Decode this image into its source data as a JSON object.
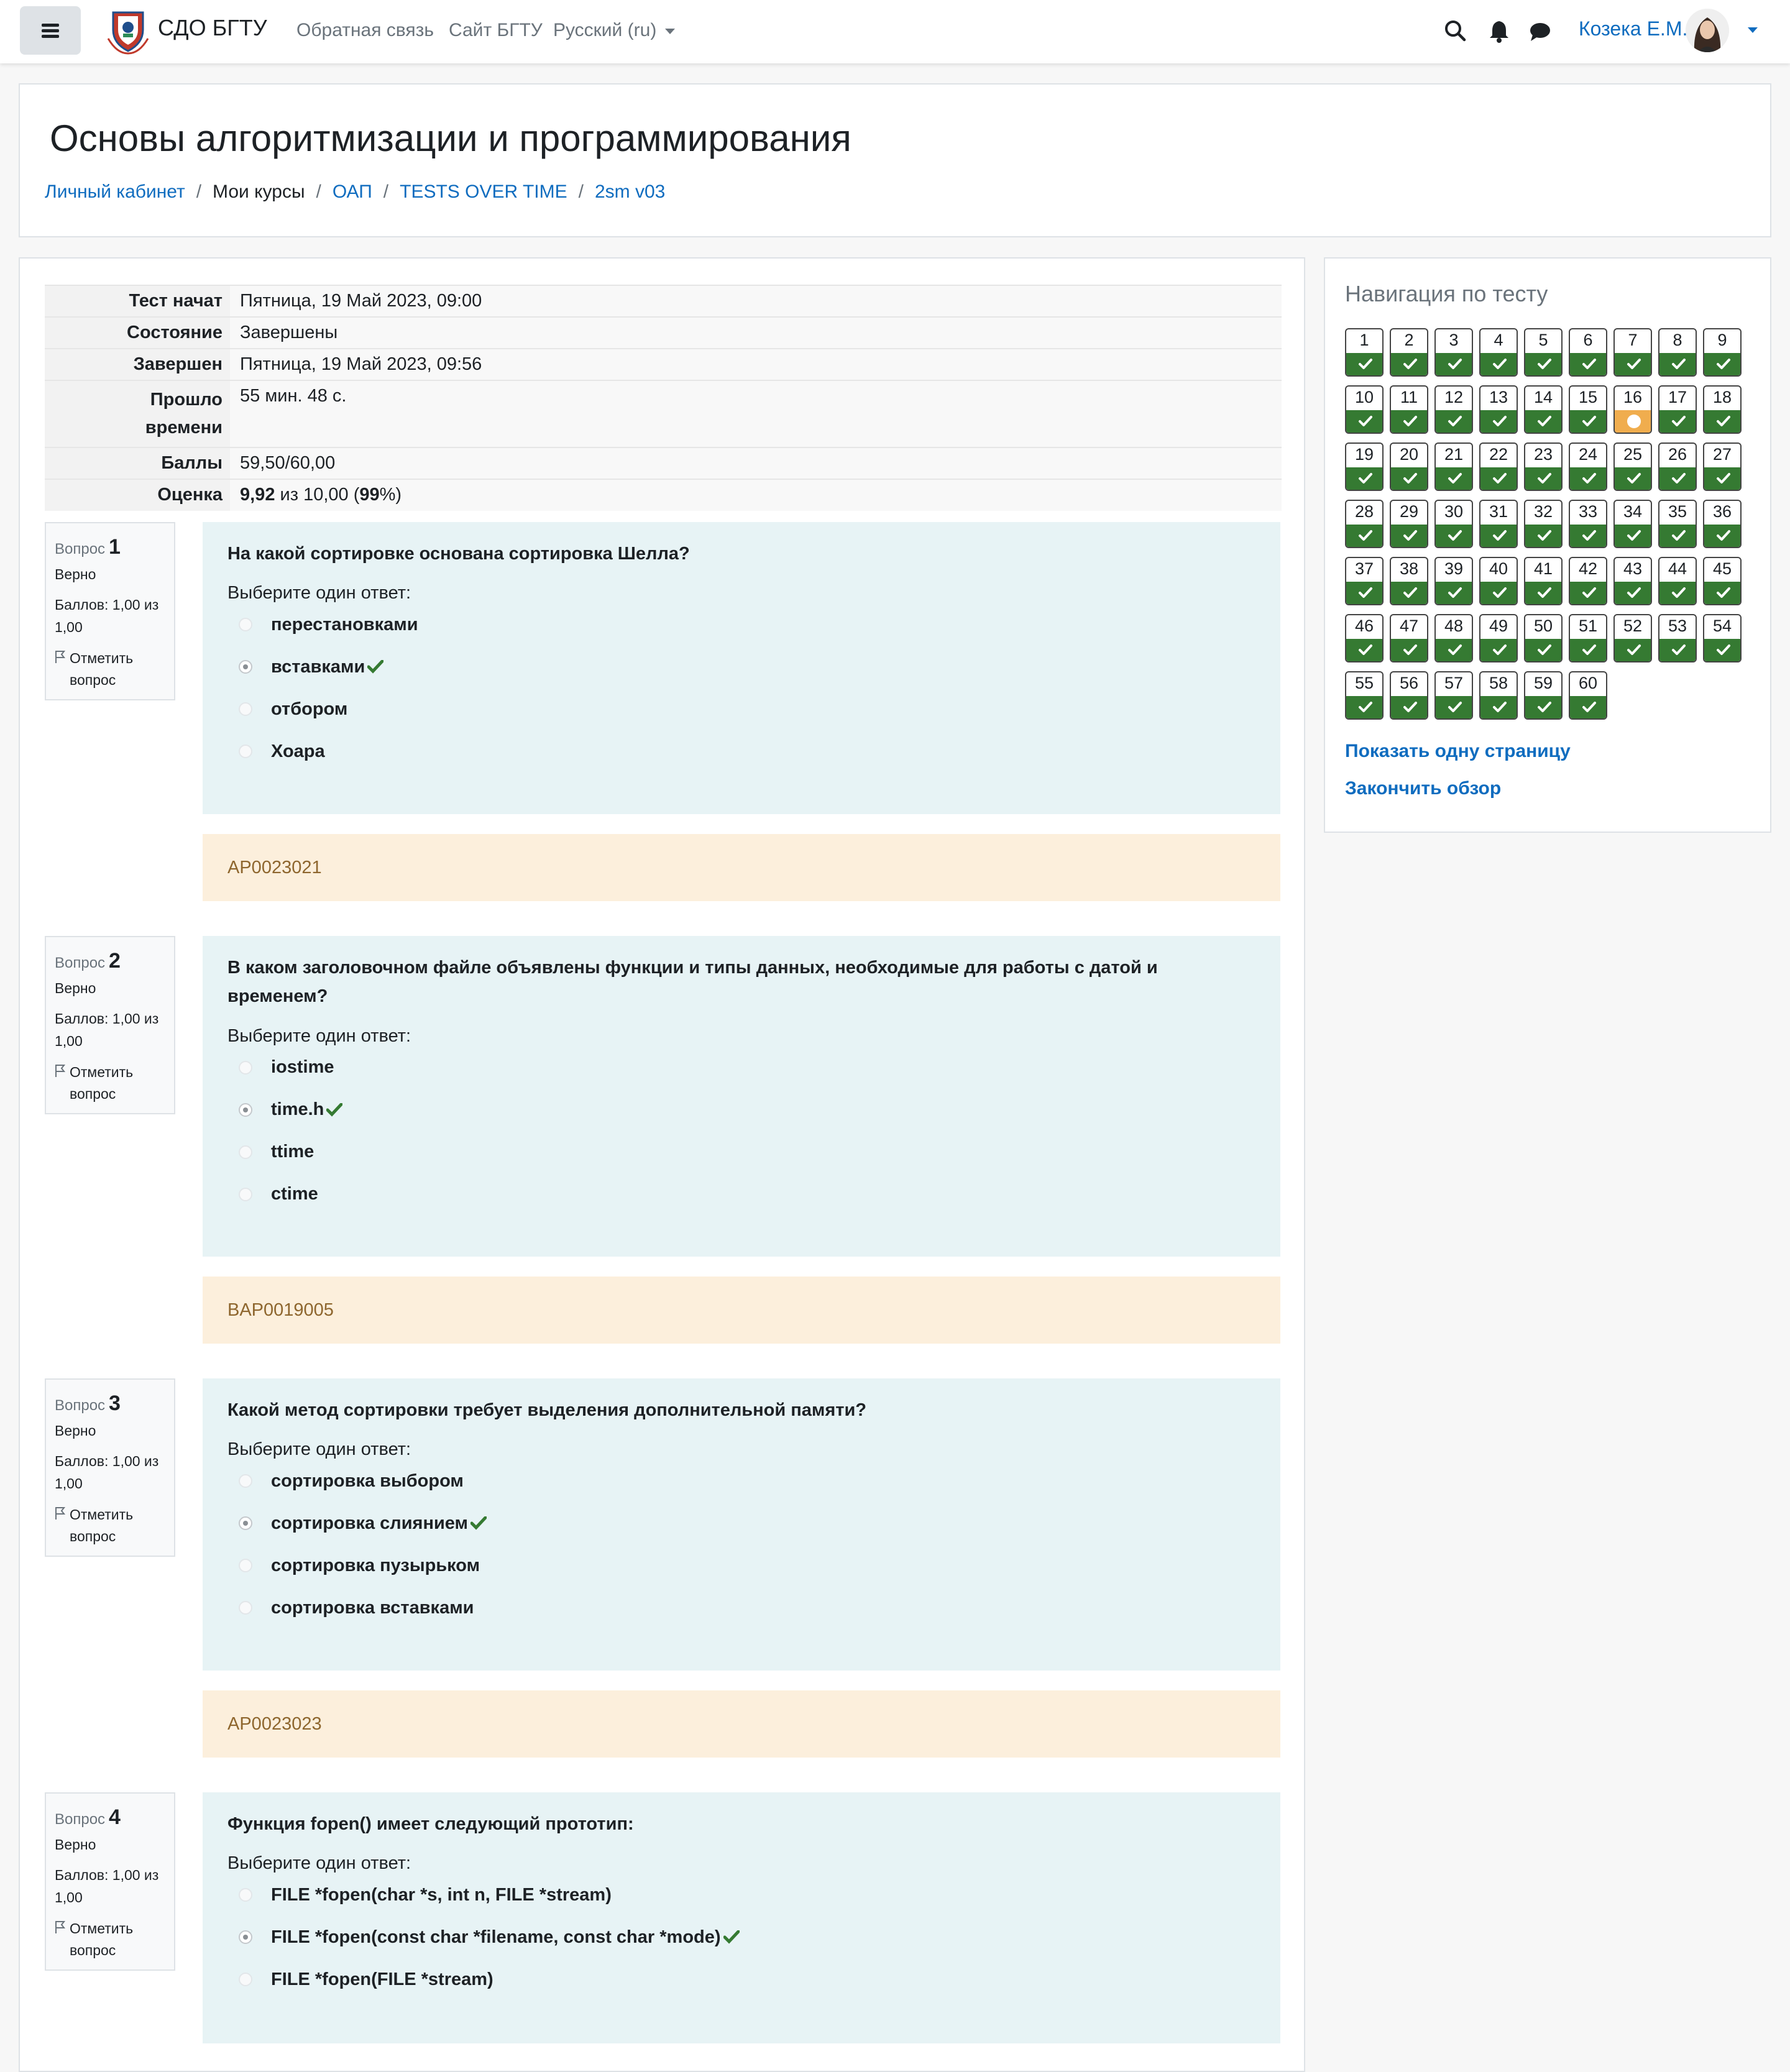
{
  "header": {
    "site_name": "СДО БГТУ",
    "links": [
      "Обратная связь",
      "Сайт БГТУ",
      "Русский (ru)"
    ],
    "user_name": "Козека Е.М."
  },
  "page": {
    "title": "Основы алгоритмизации и программирования",
    "breadcrumb": [
      "Личный кабинет",
      "Мои курсы",
      "ОАП",
      "TESTS OVER TIME",
      "2sm v03"
    ]
  },
  "summary": [
    {
      "label": "Тест начат",
      "value": "Пятница, 19 Май 2023, 09:00"
    },
    {
      "label": "Состояние",
      "value": "Завершены"
    },
    {
      "label": "Завершен",
      "value": "Пятница, 19 Май 2023, 09:56"
    },
    {
      "label": "Прошло времени",
      "value": "55 мин. 48 с."
    },
    {
      "label": "Баллы",
      "value": "59,50/60,00"
    },
    {
      "label": "Оценка",
      "grade": "9,92",
      "of": "из 10,00 (",
      "percent": "99",
      "suffix": "%)"
    }
  ],
  "question_meta": {
    "label": "Вопрос",
    "status": "Верно",
    "points": "Баллов: 1,00 из 1,00",
    "flag": "Отметить вопрос",
    "prompt": "Выберите один ответ:"
  },
  "questions": [
    {
      "number": "1",
      "text": "На какой сортировке основана сортировка Шелла?",
      "answers": [
        "перестановками",
        "вставками",
        "отбором",
        "Хоара"
      ],
      "selected": 1,
      "feedback": "AP0023021"
    },
    {
      "number": "2",
      "text": "В каком заголовочном файле объявлены функции и типы данных, необходимые для работы с датой и временем?",
      "answers": [
        "iostime",
        "time.h",
        "ttime",
        "ctime"
      ],
      "selected": 1,
      "feedback": "BAP0019005"
    },
    {
      "number": "3",
      "text": "Какой метод сортировки требует выделения дополнительной памяти?",
      "answers": [
        "сортировка выбором",
        "сортировка слиянием",
        "сортировка пузырьком",
        "сортировка вставками"
      ],
      "selected": 1,
      "feedback": "AP0023023"
    },
    {
      "number": "4",
      "text": "Функция fopen() имеет следующий прототип:",
      "answers": [
        "FILE *fopen(char *s, int n, FILE *stream)",
        "FILE *fopen(const char *filename, const char *mode)",
        "FILE *fopen(FILE *stream)"
      ],
      "selected": 1,
      "feedback": ""
    }
  ],
  "navigation": {
    "title": "Навигация по тесту",
    "total": 60,
    "partial": [
      16
    ],
    "show_one_page": "Показать одну страницу",
    "finish_review": "Закончить обзор"
  },
  "colors": {
    "correct": "#357a32",
    "partial": "#f0ad4e",
    "link": "#0f6cbf",
    "question_bg": "#e7f3f5",
    "feedback_bg": "#fcefdc"
  }
}
